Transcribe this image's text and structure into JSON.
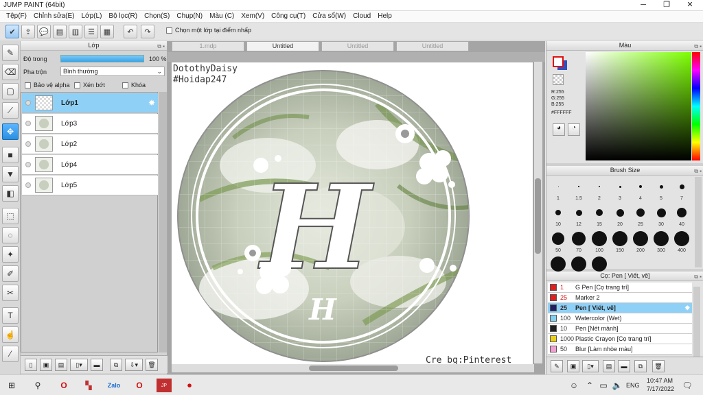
{
  "window": {
    "title": "JUMP PAINT (64bit)"
  },
  "menu": [
    "Tệp(F)",
    "Chỉnh sửa(E)",
    "Lớp(L)",
    "Bộ lọc(R)",
    "Chọn(S)",
    "Chụp(N)",
    "Màu (C)",
    "Xem(V)",
    "Công cụ(T)",
    "Cửa sổ(W)",
    "Cloud",
    "Help"
  ],
  "toolbar": {
    "click_layer_label": "Chọn một lớp tại điểm nhấp"
  },
  "layer_panel": {
    "title": "Lớp",
    "opacity_label": "Độ trong",
    "opacity_value": "100 %",
    "opacity": 1.0,
    "blend_label": "Pha trộn",
    "blend_value": "Bình thường",
    "protect_alpha": "Bảo vệ alpha",
    "clip": "Xén bớt",
    "lock": "Khóa",
    "layers": [
      "Lớp1",
      "Lớp3",
      "Lớp2",
      "Lớp4",
      "Lớp5"
    ],
    "selected_index": 0
  },
  "canvas": {
    "tabs": [
      "1.mdp",
      "Untitled",
      "Untitled",
      "Untitled"
    ],
    "active_tab": 1,
    "text_top_1": "DotothyDaisy",
    "text_top_2": "#Hoidap247",
    "text_bottom": "Cre bg:Pinterest"
  },
  "color_panel": {
    "title": "Màu",
    "r": "R:255",
    "g": "G:255",
    "b": "B:255",
    "hex": "#FFFFFF",
    "primary_color": "#e01010",
    "secondary_color": "#3050c0"
  },
  "brush_panel": {
    "title": "Brush Size",
    "sizes": [
      "1",
      "1.5",
      "2",
      "3",
      "4",
      "5",
      "7",
      "10",
      "12",
      "15",
      "20",
      "25",
      "30",
      "40",
      "50",
      "70",
      "100",
      "150",
      "200",
      "300",
      "400"
    ]
  },
  "sub_tool_panel": {
    "title": "Cọ: Pen [ Viết, vẽ]",
    "items": [
      {
        "size": "1",
        "name": "G Pen [Cọ trang trí]",
        "color": "#e02020"
      },
      {
        "size": "25",
        "name": "Marker 2",
        "color": "#e02020"
      },
      {
        "size": "25",
        "name": "Pen [ Viết, vẽ]",
        "color": "#202060"
      },
      {
        "size": "100",
        "name": "Watercolor (Wet)",
        "color": "#80d0f0"
      },
      {
        "size": "10",
        "name": "Pen [Nét mảnh]",
        "color": "#202020"
      },
      {
        "size": "1000",
        "name": "Plastic Crayon [Cọ trang trí]",
        "color": "#e8d020"
      },
      {
        "size": "50",
        "name": "Blur [Làm nhòe màu]",
        "color": "#f0a0d0"
      }
    ],
    "selected_index": 2
  },
  "taskbar": {
    "time": "10:47 AM",
    "date": "7/17/2022",
    "lang": "ENG"
  }
}
